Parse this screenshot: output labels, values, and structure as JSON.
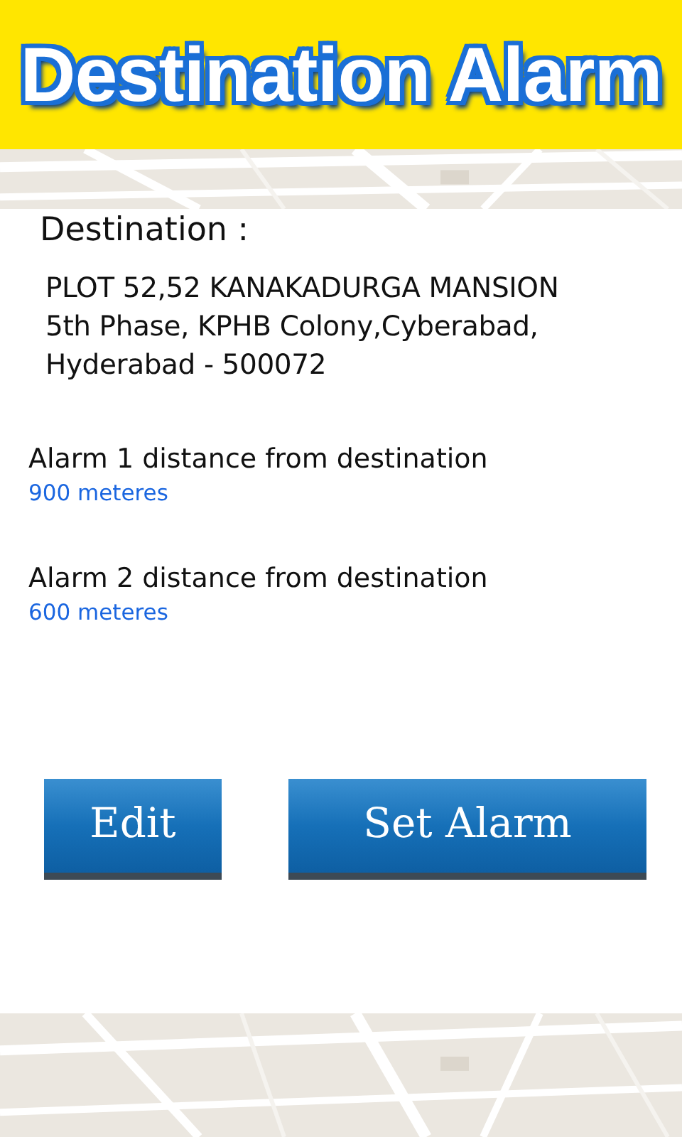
{
  "header": {
    "title": "Destination Alarm"
  },
  "destination": {
    "label": "Destination :",
    "address_lines": [
      "PLOT 52,52 KANAKADURGA MANSION",
      "5th Phase, KPHB Colony,Cyberabad,",
      "Hyderabad - 500072"
    ]
  },
  "alarms": [
    {
      "label": "Alarm 1 distance from destination",
      "distance": "900 meteres"
    },
    {
      "label": "Alarm 2 distance from destination",
      "distance": "600 meteres"
    }
  ],
  "buttons": [
    {
      "label": "Edit",
      "kind": "narrow"
    },
    {
      "label": "Set Alarm",
      "kind": "wide"
    }
  ]
}
